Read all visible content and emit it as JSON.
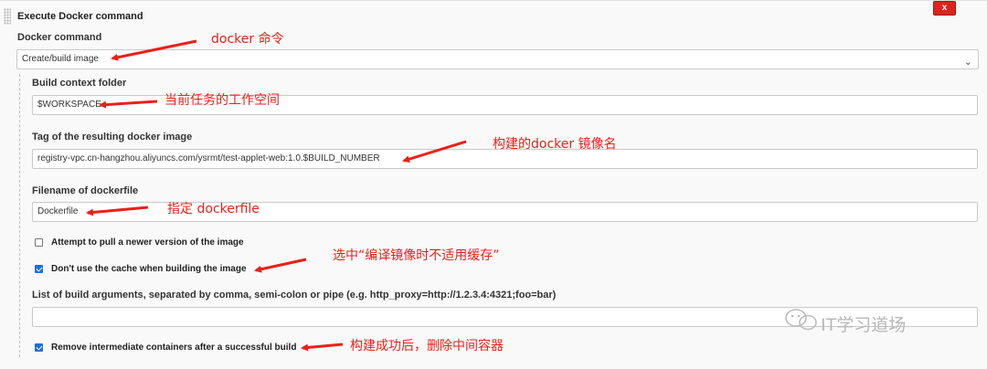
{
  "header": {
    "title": "Execute Docker command",
    "close_label": "x"
  },
  "docker_command": {
    "label": "Docker command",
    "value": "Create/build image"
  },
  "build_context": {
    "label": "Build context folder",
    "value": "$WORKSPACE"
  },
  "tag": {
    "label": "Tag of the resulting docker image",
    "value": "registry-vpc.cn-hangzhou.aliyuncs.com/ysrmt/test-applet-web:1.0.$BUILD_NUMBER"
  },
  "dockerfile": {
    "label": "Filename of dockerfile",
    "value": "Dockerfile"
  },
  "options": {
    "pull_label": "Attempt to pull a newer version of the image",
    "pull_checked": false,
    "nocache_label": "Don't use the cache when building the image",
    "nocache_checked": true,
    "build_args_label": "List of build arguments, separated by comma, semi-colon or pipe (e.g. http_proxy=http://1.2.3.4:4321;foo=bar)",
    "build_args_value": "",
    "remove_label": "Remove intermediate containers after a successful build",
    "remove_checked": true
  },
  "annotations": {
    "docker_cmd": "docker 命令",
    "context": "当前任务的工作空间",
    "image_name": "构建的docker 镜像名",
    "dockerfile": "指定 dockerfile",
    "nocache": "选中“编译镜像时不适用缓存”",
    "remove": "构建成功后，删除中间容器"
  },
  "watermark": {
    "text": "IT学习道场"
  },
  "colors": {
    "annotation": "#e8211a",
    "checkbox": "#1e6fd9",
    "close_button": "#d9251f"
  }
}
